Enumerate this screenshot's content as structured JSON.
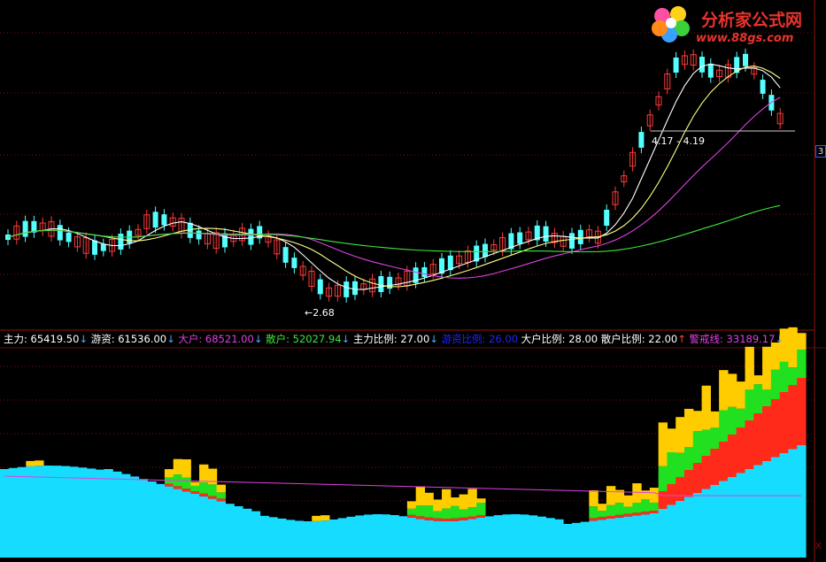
{
  "logo": {
    "name": "分析家公式网",
    "url": "www.88gs.com"
  },
  "axis_tag": "3",
  "corner_mark": "X",
  "legend": [
    {
      "label": "主力: ",
      "value": "65419.50",
      "arrow": "↓",
      "color": "#ffffff",
      "arrow_color": "#4aa8ff"
    },
    {
      "label": "游资: ",
      "value": "61536.00",
      "arrow": "↓",
      "color": "#ffffff",
      "arrow_color": "#4aa8ff"
    },
    {
      "label": "大户: ",
      "value": "68521.00",
      "arrow": "↓",
      "color": "#e040e0",
      "arrow_color": "#4aa8ff"
    },
    {
      "label": "散户: ",
      "value": "52027.94",
      "arrow": "↓",
      "color": "#3ce63c",
      "arrow_color": "#4aa8ff"
    },
    {
      "label": "主力比例: ",
      "value": "27.00",
      "arrow": "↓",
      "color": "#ffffff",
      "arrow_color": "#4aa8ff"
    },
    {
      "label": "游资比例: ",
      "value": "26.00",
      "arrow": "",
      "color": "#2222ff",
      "arrow_color": "#4aa8ff"
    },
    {
      "label": "大户比例: ",
      "value": "28.00",
      "arrow": "",
      "color": "#ffffff",
      "arrow_color": "#4aa8ff"
    },
    {
      "label": "散户比例: ",
      "value": "22.00",
      "arrow": "↑",
      "color": "#ffffff",
      "arrow_color": "#ff4040"
    },
    {
      "label": "警戒线: ",
      "value": "33189.17",
      "arrow": "↓",
      "color": "#e040e0",
      "arrow_color": "#4aa8ff"
    }
  ],
  "chart_data": [
    {
      "type": "candlestick",
      "price_labels": {
        "low": "2.68",
        "high": "4.17 - 4.19"
      },
      "candles_count": 90,
      "colors": {
        "up": "#ff3a3a",
        "down": "#54ffff",
        "ma5": "#ffffff",
        "ma10": "#ffff88",
        "ma20": "#e040e0",
        "ma60": "#3ce63c"
      }
    },
    {
      "type": "area",
      "stacked": true,
      "series": [
        {
          "name": "散户",
          "color": "#16dcff"
        },
        {
          "name": "大户",
          "color": "#ff2a1a"
        },
        {
          "name": "游资",
          "color": "#20e020"
        },
        {
          "name": "主力",
          "color": "#ffcc00"
        }
      ],
      "colors": {
        "alert_line": "#e040e0"
      }
    }
  ]
}
